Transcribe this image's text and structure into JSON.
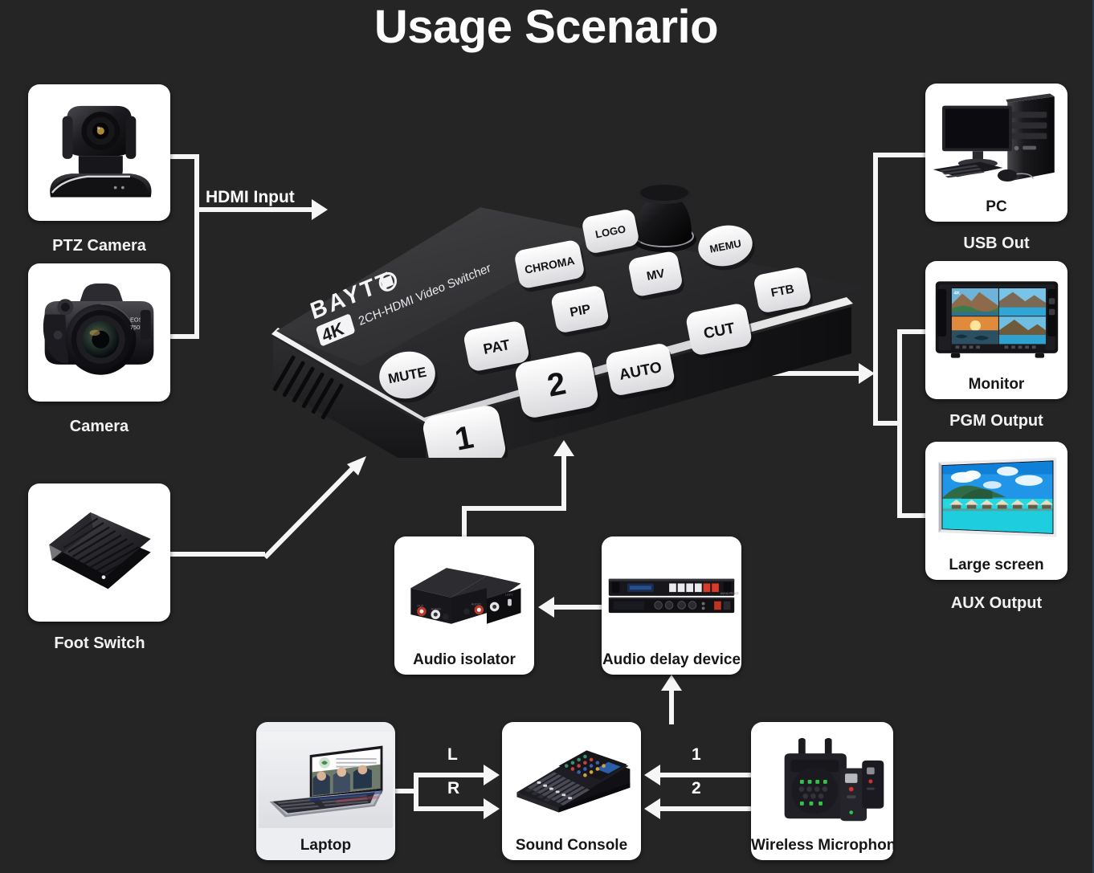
{
  "page": {
    "title": "Usage Scenario",
    "background_color": "#252525",
    "card_background": "#ffffff",
    "wire_color": "#f6f6f6",
    "title_color": "#fdfdfd"
  },
  "nodes": [
    {
      "id": "ptz-camera",
      "label": "PTZ Camera",
      "label_position": "below-card",
      "icon": "ptz-camera-icon"
    },
    {
      "id": "camera",
      "label": "Camera",
      "label_position": "below-card",
      "icon": "dslr-camera-icon"
    },
    {
      "id": "foot-switch",
      "label": "Foot Switch",
      "label_position": "below-card",
      "icon": "foot-switch-icon"
    },
    {
      "id": "video-switcher",
      "label": "",
      "label_position": "none",
      "icon": "video-switcher-icon"
    },
    {
      "id": "pc",
      "label": "PC",
      "label_position": "in-card",
      "icon": "desktop-pc-icon"
    },
    {
      "id": "monitor",
      "label": "Monitor",
      "label_position": "in-card",
      "icon": "broadcast-monitor-icon"
    },
    {
      "id": "large-screen",
      "label": "Large screen",
      "label_position": "in-card",
      "icon": "large-screen-icon"
    },
    {
      "id": "audio-isolator",
      "label": "Audio isolator",
      "label_position": "in-card",
      "icon": "audio-isolator-icon"
    },
    {
      "id": "audio-delay",
      "label": "Audio delay device",
      "label_position": "in-card",
      "icon": "rack-unit-icon"
    },
    {
      "id": "laptop",
      "label": "Laptop",
      "label_position": "in-card",
      "icon": "laptop-icon"
    },
    {
      "id": "sound-console",
      "label": "Sound Console",
      "label_position": "in-card",
      "icon": "mixing-console-icon"
    },
    {
      "id": "wireless-mic",
      "label": "Wireless Microphone",
      "label_position": "in-card",
      "icon": "wireless-microphone-icon"
    }
  ],
  "captions": {
    "ptz_camera": "PTZ Camera",
    "camera": "Camera",
    "foot_switch": "Foot Switch",
    "usb_out": "USB Out",
    "pgm_output": "PGM Output",
    "aux_output": "AUX Output"
  },
  "connections": [
    {
      "from": "ptz-camera",
      "to": "video-switcher",
      "label": "HDMI Input"
    },
    {
      "from": "camera",
      "to": "video-switcher",
      "label": ""
    },
    {
      "from": "foot-switch",
      "to": "video-switcher",
      "label": ""
    },
    {
      "from": "video-switcher",
      "to": "pc",
      "label": "USB Out"
    },
    {
      "from": "video-switcher",
      "to": "monitor",
      "label": "PGM Output"
    },
    {
      "from": "video-switcher",
      "to": "large-screen",
      "label": "AUX Output"
    },
    {
      "from": "audio-isolator",
      "to": "video-switcher",
      "label": ""
    },
    {
      "from": "audio-delay",
      "to": "audio-isolator",
      "label": ""
    },
    {
      "from": "sound-console",
      "to": "audio-delay",
      "label": ""
    },
    {
      "from": "laptop",
      "to": "sound-console",
      "label": "L"
    },
    {
      "from": "laptop",
      "to": "sound-console",
      "label": "R"
    },
    {
      "from": "wireless-mic",
      "to": "sound-console",
      "label": "1"
    },
    {
      "from": "wireless-mic",
      "to": "sound-console",
      "label": "2"
    }
  ],
  "wire_labels": {
    "hdmi_input": "HDMI Input",
    "left": "L",
    "right": "R",
    "mic1": "1",
    "mic2": "2"
  },
  "switcher": {
    "brand": "BAYTTO",
    "resolution_badge": "4K",
    "model_text": "2CH-HDMI Video Switcher",
    "buttons": [
      "CHROMA",
      "LOGO",
      "MV",
      "MENU",
      "FTB",
      "PIP",
      "PAT",
      "AUTO",
      "CUT",
      "MUTE",
      "1",
      "2"
    ],
    "has_knob": true
  },
  "cards": {
    "pc_label": "PC",
    "monitor_label": "Monitor",
    "large_screen_label": "Large screen",
    "audio_isolator_label": "Audio isolator",
    "audio_delay_label": "Audio delay device",
    "laptop_label": "Laptop",
    "sound_console_label": "Sound Console",
    "wireless_mic_label": "Wireless Microphone"
  }
}
